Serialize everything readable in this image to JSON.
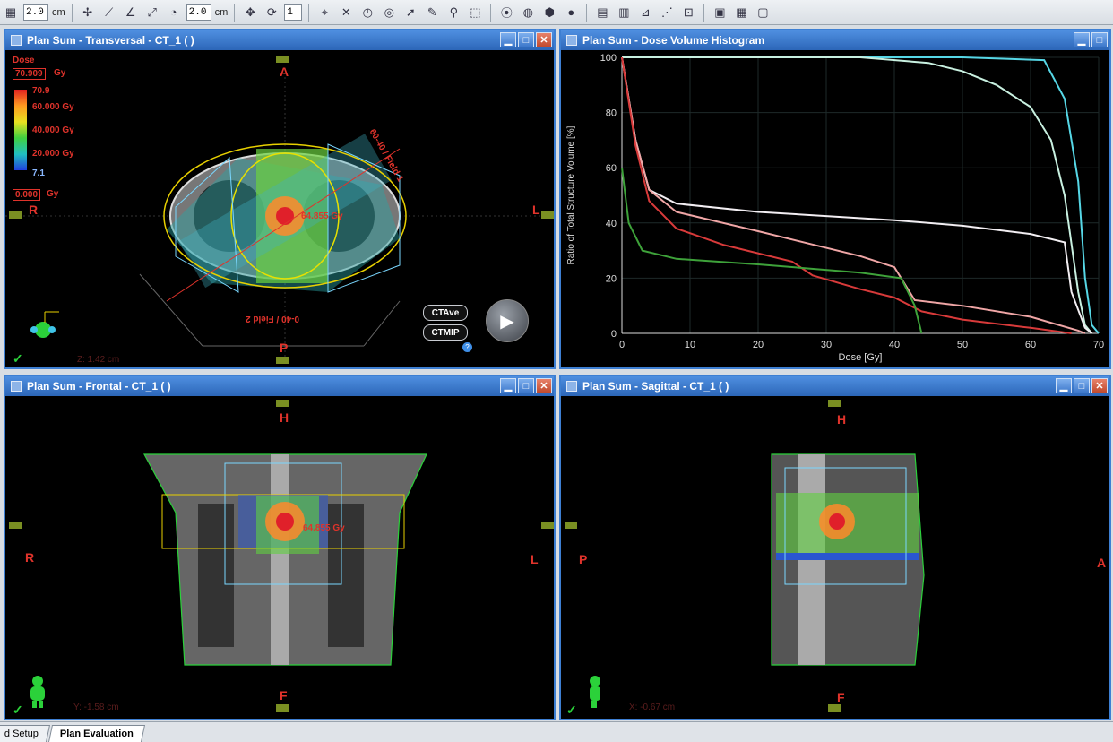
{
  "toolbar": {
    "zoom_value_1": "2.0",
    "unit_1": "cm",
    "zoom_value_2": "2.0",
    "unit_2": "cm",
    "step_value": "1"
  },
  "panes": {
    "transversal": {
      "title": "Plan Sum - Transversal - CT_1 ( )",
      "orient_top": "A",
      "orient_bottom": "P",
      "orient_left": "R",
      "orient_right": "L",
      "dose_title": "Dose",
      "dose_max": "70.909",
      "dose_unit": "Gy",
      "scale_top": "70.9",
      "scale_60": "60.000 Gy",
      "scale_40": "40.000 Gy",
      "scale_20": "20.000 Gy",
      "scale_bottom": "7.1",
      "dose_min": "0.000",
      "point_dose": "64.855 Gy",
      "field_label_1": "60-40 / Field 1",
      "field_label_2": "0-40 / Field 2",
      "ct_ave": "CTAve",
      "ct_mip": "CTMIP",
      "coord": "Z: 1.42 cm"
    },
    "dvh": {
      "title": "Plan Sum - Dose Volume Histogram"
    },
    "frontal": {
      "title": "Plan Sum - Frontal - CT_1 ( )",
      "orient_top": "H",
      "orient_bottom": "F",
      "orient_left": "R",
      "orient_right": "L",
      "point_dose": "64.855 Gy",
      "coord": "Y: -1.58 cm"
    },
    "sagittal": {
      "title": "Plan Sum - Sagittal - CT_1 ( )",
      "orient_top": "H",
      "orient_bottom": "F",
      "orient_left": "P",
      "orient_right": "A",
      "coord": "X: -0.67 cm"
    }
  },
  "tabs": {
    "setup": "d Setup",
    "evaluation": "Plan Evaluation"
  },
  "colors": {
    "titlebar": "#2c66b8",
    "annotation_red": "#e0332b",
    "curve_cyan": "#56d7e6",
    "curve_white": "#f2eef2",
    "curve_light": "#c8f0e0",
    "curve_pink": "#f0a6a6",
    "curve_red": "#d83a3a",
    "curve_green": "#3ea23a"
  },
  "chart_data": {
    "type": "line",
    "xlabel": "Dose [Gy]",
    "ylabel": "Ratio of Total Structure Volume [%]",
    "xlim": [
      0,
      70
    ],
    "ylim": [
      0,
      100
    ],
    "x_ticks": [
      0,
      10,
      20,
      30,
      40,
      50,
      60,
      70
    ],
    "y_ticks": [
      0,
      20,
      40,
      60,
      80,
      100
    ],
    "grid": true,
    "series": [
      {
        "color": "#56d7e6",
        "points": [
          [
            0,
            100
          ],
          [
            10,
            100
          ],
          [
            20,
            100
          ],
          [
            30,
            100
          ],
          [
            40,
            100
          ],
          [
            50,
            100
          ],
          [
            62,
            99
          ],
          [
            65,
            85
          ],
          [
            67,
            55
          ],
          [
            68,
            20
          ],
          [
            69,
            3
          ],
          [
            70,
            0
          ]
        ]
      },
      {
        "color": "#c8f0e0",
        "points": [
          [
            0,
            100
          ],
          [
            10,
            100
          ],
          [
            20,
            100
          ],
          [
            35,
            100
          ],
          [
            45,
            98
          ],
          [
            50,
            95
          ],
          [
            55,
            90
          ],
          [
            60,
            82
          ],
          [
            63,
            70
          ],
          [
            65,
            50
          ],
          [
            67,
            15
          ],
          [
            68,
            3
          ],
          [
            69,
            0
          ]
        ]
      },
      {
        "color": "#f2eef2",
        "points": [
          [
            0,
            100
          ],
          [
            2,
            70
          ],
          [
            4,
            52
          ],
          [
            8,
            47
          ],
          [
            20,
            44
          ],
          [
            40,
            41
          ],
          [
            50,
            39
          ],
          [
            60,
            36
          ],
          [
            65,
            33
          ],
          [
            66,
            15
          ],
          [
            68,
            2
          ],
          [
            69,
            0
          ]
        ]
      },
      {
        "color": "#f0a6a6",
        "points": [
          [
            0,
            100
          ],
          [
            2,
            70
          ],
          [
            4,
            52
          ],
          [
            8,
            44
          ],
          [
            20,
            37
          ],
          [
            35,
            28
          ],
          [
            40,
            24
          ],
          [
            43,
            12
          ],
          [
            50,
            10
          ],
          [
            60,
            6
          ],
          [
            67,
            1
          ],
          [
            68,
            0
          ]
        ]
      },
      {
        "color": "#d83a3a",
        "points": [
          [
            0,
            100
          ],
          [
            2,
            68
          ],
          [
            4,
            48
          ],
          [
            8,
            38
          ],
          [
            15,
            32
          ],
          [
            25,
            26
          ],
          [
            28,
            21
          ],
          [
            35,
            16
          ],
          [
            40,
            13
          ],
          [
            44,
            8
          ],
          [
            50,
            5
          ],
          [
            60,
            2
          ],
          [
            66,
            0
          ]
        ]
      },
      {
        "color": "#3ea23a",
        "points": [
          [
            0,
            60
          ],
          [
            1,
            40
          ],
          [
            3,
            30
          ],
          [
            8,
            27
          ],
          [
            20,
            25
          ],
          [
            35,
            22
          ],
          [
            41,
            20
          ],
          [
            43,
            10
          ],
          [
            44,
            0
          ]
        ]
      }
    ]
  }
}
